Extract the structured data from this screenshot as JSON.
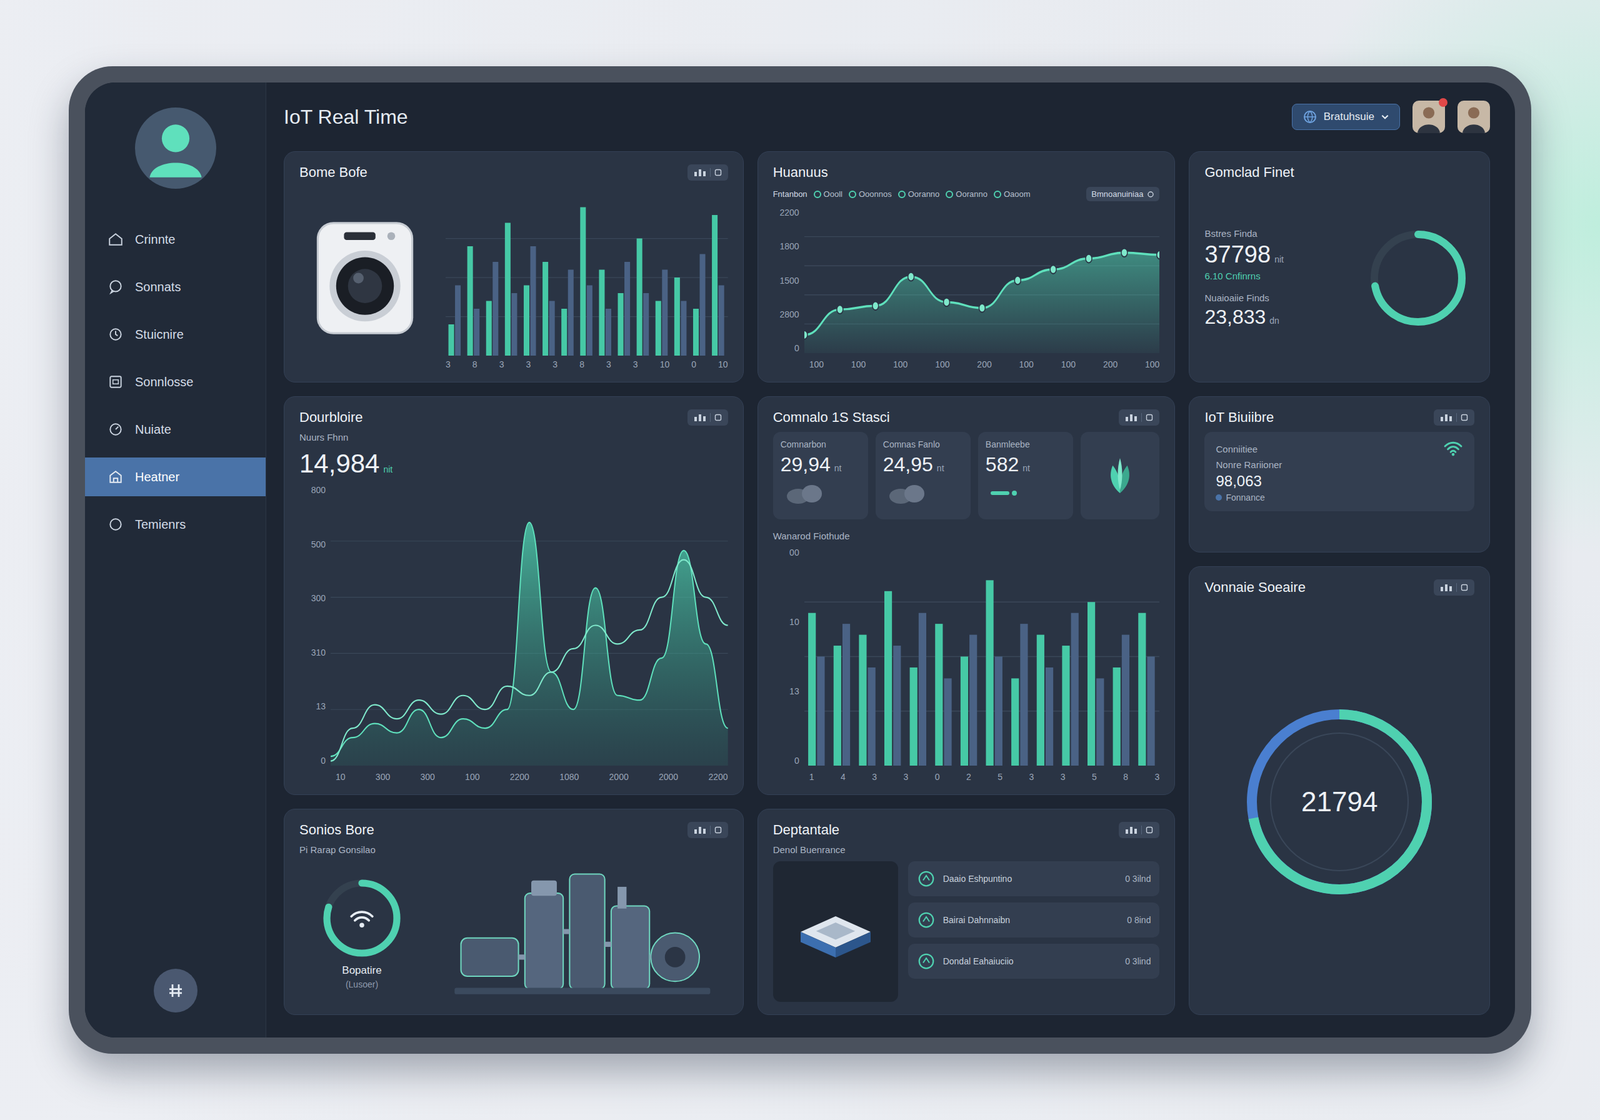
{
  "app": {
    "title": "IoT Real Time",
    "account": "Bratuhsuie",
    "users": [
      {
        "badge": true
      },
      {
        "badge": false
      }
    ]
  },
  "sidebar": {
    "items": [
      {
        "label": "Crinnte",
        "selected": false
      },
      {
        "label": "Sonnats",
        "selected": false
      },
      {
        "label": "Stuicnire",
        "selected": false
      },
      {
        "label": "Sonnlosse",
        "selected": false
      },
      {
        "label": "Nuiate",
        "selected": false
      },
      {
        "label": "Heatner",
        "selected": true
      },
      {
        "label": "Temienrs",
        "selected": false
      }
    ]
  },
  "bome_bofe": {
    "title": "Bome Bofe",
    "x_ticks": [
      "3",
      "8",
      "3",
      "3",
      "3",
      "8",
      "3",
      "3",
      "10",
      "0",
      "10"
    ],
    "series": [
      {
        "color": "#46c9a6",
        "values": [
          20,
          70,
          35,
          85,
          45,
          60,
          30,
          95,
          55,
          40,
          75,
          35,
          50,
          30,
          90
        ]
      },
      {
        "color": "#4a6285",
        "values": [
          45,
          30,
          60,
          40,
          70,
          35,
          55,
          45,
          30,
          60,
          40,
          55,
          35,
          65,
          45
        ]
      }
    ]
  },
  "huanuus": {
    "title": "Huanuus",
    "legend_label": "Fntanbon",
    "legend": [
      "Oooll",
      "Ooonnos",
      "Ooranno",
      "Ooranno",
      "Oaoom"
    ],
    "button": "Bmnoanuiniaa",
    "y_ticks": [
      "2200",
      "1800",
      "1500",
      "2800",
      "0"
    ],
    "x_ticks": [
      "100",
      "100",
      "100",
      "100",
      "200",
      "100",
      "100",
      "200",
      "100"
    ],
    "values": [
      250,
      600,
      650,
      1050,
      700,
      620,
      1000,
      1150,
      1300,
      1380,
      1350
    ]
  },
  "gomclad": {
    "title": "Gomclad Finet",
    "primary_label": "Bstres Finda",
    "primary_value": "37798",
    "primary_unit": "nit",
    "change": "6.10 Cnfinrns",
    "secondary_label": "Nuaioaiie Finds",
    "secondary_value": "23,833",
    "secondary_unit": "dn",
    "level": 0.72
  },
  "dourbloire": {
    "title": "Dourbloire",
    "label": "Nuurs Fhnn",
    "value": "14,984",
    "unit": "nit",
    "y_ticks": [
      "800",
      "500",
      "300",
      "310",
      "13",
      "0"
    ],
    "x_ticks": [
      "10",
      "300",
      "300",
      "100",
      "2200",
      "1080",
      "2000",
      "2000",
      "2200"
    ],
    "area": [
      20,
      60,
      90,
      70,
      120,
      60,
      100,
      80,
      120,
      520,
      200,
      120,
      380,
      150,
      140,
      230,
      460,
      260,
      80
    ],
    "line": [
      10,
      80,
      130,
      100,
      140,
      110,
      150,
      120,
      170,
      150,
      200,
      250,
      300,
      260,
      290,
      360,
      440,
      360,
      300
    ]
  },
  "comnalo": {
    "title": "Comnalo 1S Stasci",
    "stats": [
      {
        "label": "Comnarbon",
        "value": "29,94",
        "unit": "nt",
        "kind": "clouds"
      },
      {
        "label": "Comnas Fanlo",
        "value": "24,95",
        "unit": "nt",
        "kind": "clouds"
      },
      {
        "label": "Banmleebe",
        "value": "582",
        "unit": "nt",
        "kind": "dash"
      }
    ],
    "chart_title": "Wanarod Fiothude",
    "y_ticks": [
      "00",
      "10",
      "13",
      "0"
    ],
    "x_ticks": [
      "1",
      "4",
      "3",
      "3",
      "0",
      "2",
      "5",
      "3",
      "3",
      "5",
      "8",
      "3"
    ],
    "series": [
      {
        "color": "#46c9a6",
        "values": [
          70,
          55,
          60,
          80,
          45,
          65,
          50,
          85,
          40,
          60,
          55,
          75,
          45,
          70
        ]
      },
      {
        "color": "#4a6285",
        "values": [
          50,
          65,
          45,
          55,
          70,
          40,
          60,
          50,
          65,
          45,
          70,
          40,
          60,
          50
        ]
      }
    ]
  },
  "iot": {
    "title": "IoT Biuiibre",
    "subtitle": "Conniitiee",
    "label": "Nonre Rariioner",
    "value": "98,063",
    "status": "Fonnance"
  },
  "vonnaie": {
    "title": "Vonnaie Soeaire",
    "value": "21794",
    "level": 0.72
  },
  "sonios": {
    "title": "Sonios Bore",
    "subtitle": "Pi Rarap Gonsilao",
    "status": "Bopatire",
    "note": "(Lusoer)",
    "level": 0.8
  },
  "deptantale": {
    "title": "Deptantale",
    "subtitle": "Denol Buenrance",
    "items": [
      {
        "name": "Daaio Eshpuntino",
        "value": "0 3ilnd"
      },
      {
        "name": "Bairai Dahnnaibn",
        "value": "0 8ind"
      },
      {
        "name": "Dondal Eahaiuciio",
        "value": "0 3lind"
      }
    ]
  }
}
